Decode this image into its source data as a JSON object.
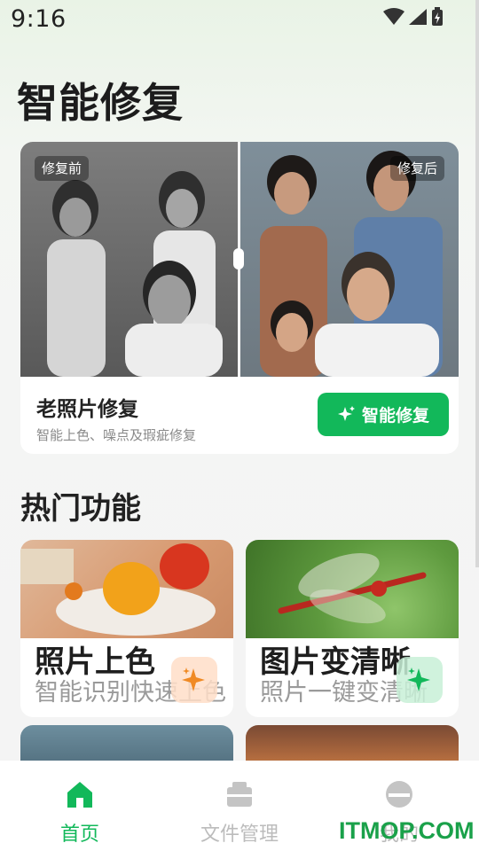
{
  "status": {
    "time": "9:16"
  },
  "page_title": "智能修复",
  "hero": {
    "tag_before": "修复前",
    "tag_after": "修复后",
    "title": "老照片修复",
    "subtitle": "智能上色、噪点及瑕疵修复",
    "button_label": "智能修复"
  },
  "section_title": "热门功能",
  "features": [
    {
      "title": "照片上色",
      "subtitle": "智能识别快速上色"
    },
    {
      "title": "图片变清晰",
      "subtitle": "照片一键变清晰"
    }
  ],
  "nav": {
    "items": [
      {
        "label": "首页",
        "icon": "home-icon"
      },
      {
        "label": "文件管理",
        "icon": "folder-icon"
      },
      {
        "label": "我的",
        "icon": "profile-icon"
      }
    ]
  },
  "watermark": "ITMOP.COM",
  "colors": {
    "accent": "#12b85a"
  }
}
